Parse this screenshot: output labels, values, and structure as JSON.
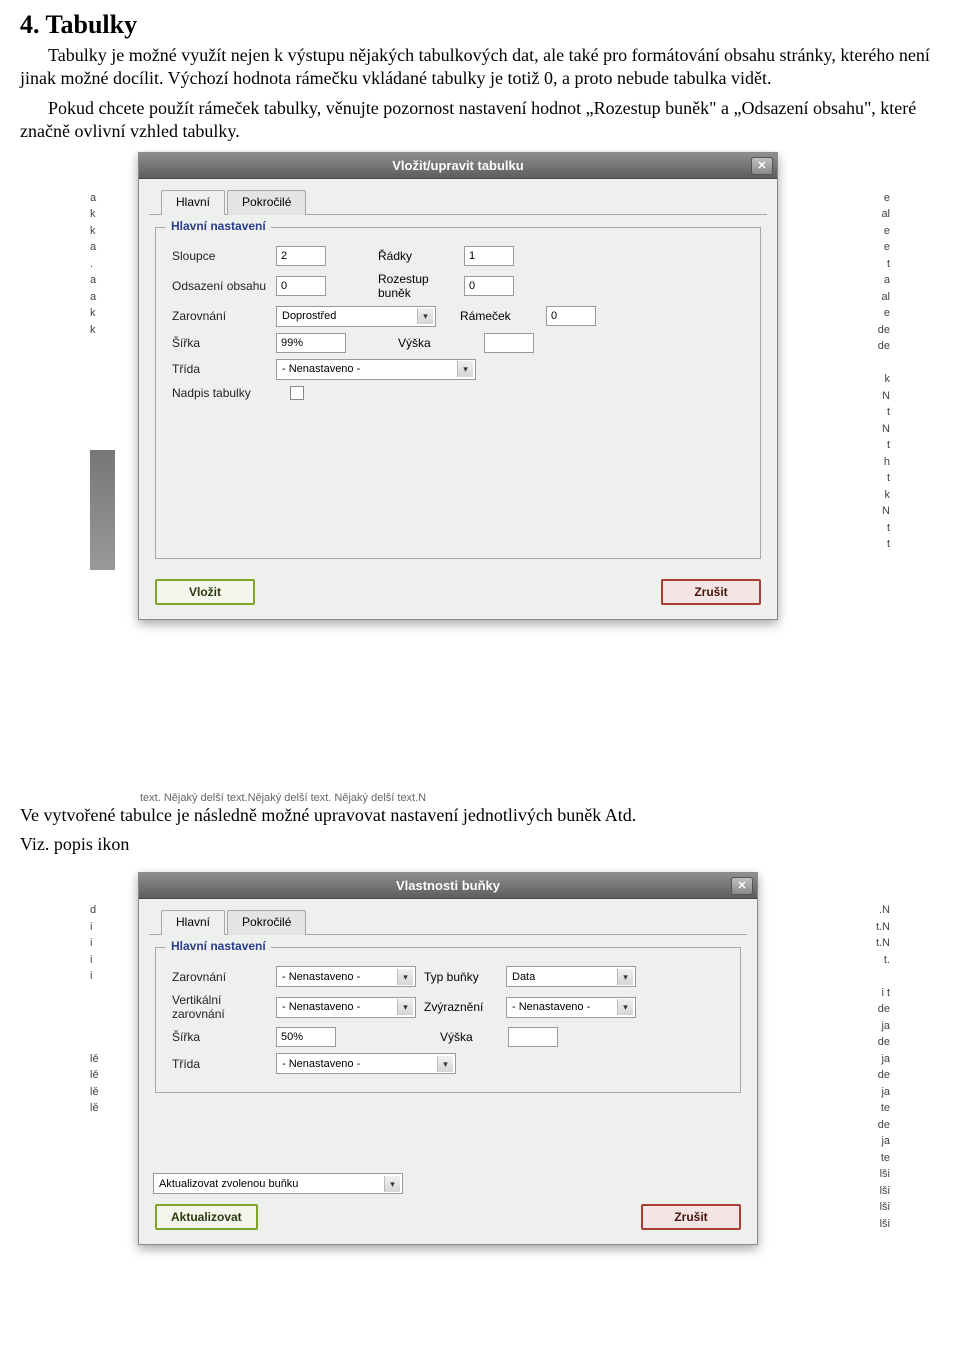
{
  "doc": {
    "heading": "4. Tabulky",
    "p1": "Tabulky je možné využít nejen k výstupu nějakých tabulkových dat, ale také pro formátování obsahu stránky, kterého není jinak možné docílit. Výchozí hodnota rámečku vkládané tabulky je totiž 0, a proto nebude tabulka vidět.",
    "p2": "Pokud chcete použít rámeček tabulky, věnujte pozornost nastavení hodnot „Rozestup buněk\" a „Odsazení obsahu\", které značně ovlivní vzhled tabulky.",
    "between": "Ve vytvořené tabulce je následně možné upravovat nastavení jednotlivých buněk  Atd.",
    "between2": "Viz. popis ikon",
    "bg_bottom": "text. Nějaký delší text.Nějaký delší text. Nějaký delší text.N"
  },
  "dialog1": {
    "title": "Vložit/upravit tabulku",
    "tab_main": "Hlavní",
    "tab_adv": "Pokročilé",
    "legend": "Hlavní nastavení",
    "cols_label": "Sloupce",
    "cols_value": "2",
    "rows_label": "Řádky",
    "rows_value": "1",
    "pad_label": "Odsazení obsahu",
    "pad_value": "0",
    "spacing_label": "Rozestup buněk",
    "spacing_value": "0",
    "align_label": "Zarovnání",
    "align_value": "Doprostřed",
    "border_label": "Rámeček",
    "border_value": "0",
    "width_label": "Šířka",
    "width_value": "99%",
    "height_label": "Výška",
    "height_value": "",
    "class_label": "Třída",
    "class_value": "- Nenastaveno -",
    "caption_label": "Nadpis tabulky",
    "btn_insert": "Vložit",
    "btn_cancel": "Zrušit"
  },
  "dialog2": {
    "title": "Vlastnosti buňky",
    "tab_main": "Hlavní",
    "tab_adv": "Pokročilé",
    "legend": "Hlavní nastavení",
    "align_label": "Zarovnání",
    "align_value": "- Nenastaveno -",
    "type_label": "Typ buňky",
    "type_value": "Data",
    "valign_label": "Vertikální zarovnání",
    "valign_value": "- Nenastaveno -",
    "highlight_label": "Zvýraznění",
    "highlight_value": "- Nenastaveno -",
    "width_label": "Šířka",
    "width_value": "50%",
    "height_label": "Výška",
    "height_value": "",
    "class_label": "Třída",
    "class_value": "- Nenastaveno -",
    "update_scope": "Aktualizovat zvolenou buňku",
    "btn_update": "Aktualizovat",
    "btn_cancel": "Zrušit"
  },
  "garble": {
    "left_frags": "a\nk\nk\na\n.\na\na\nk\nk\n\n\n\n\n\n\n\n\n\n",
    "right_frags": "e\nal\ne\ne\nt\na\nal\ne\nde\nde\n\nk\nN\nt\nN\nt\nh\nt\nk\nN\nt\nt",
    "left_frags2": "d\ni\ni\ni\ni\n\n\n\n\nlě\nlě\nlě\nlě",
    "right_frags2": ".N\nt.N\nt.N\nt.\n\ni t\nde\nja\nde\nja\nde\nja\nte\nde\nja\nte\nlši\nlši\nlši\nlši"
  }
}
